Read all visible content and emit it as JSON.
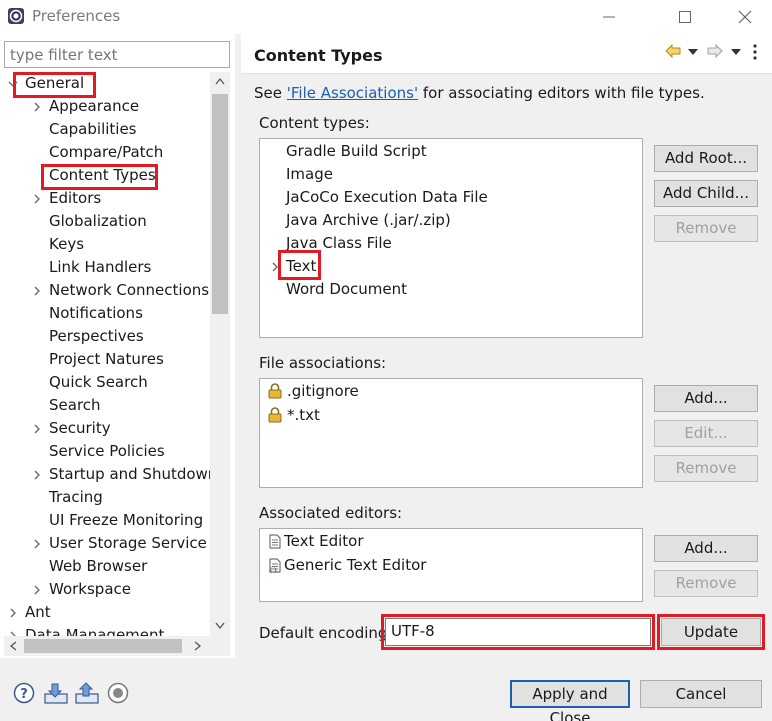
{
  "window": {
    "title": "Preferences"
  },
  "left_panel": {
    "filter_placeholder": "type filter text",
    "tree": [
      {
        "label": "General",
        "level": 0,
        "expanded": true,
        "has_children": true
      },
      {
        "label": "Appearance",
        "level": 1,
        "has_children": true
      },
      {
        "label": "Capabilities",
        "level": 1,
        "has_children": false
      },
      {
        "label": "Compare/Patch",
        "level": 1,
        "has_children": false
      },
      {
        "label": "Content Types",
        "level": 1,
        "has_children": false,
        "selected": true
      },
      {
        "label": "Editors",
        "level": 1,
        "has_children": true
      },
      {
        "label": "Globalization",
        "level": 1,
        "has_children": false
      },
      {
        "label": "Keys",
        "level": 1,
        "has_children": false
      },
      {
        "label": "Link Handlers",
        "level": 1,
        "has_children": false
      },
      {
        "label": "Network Connections",
        "level": 1,
        "has_children": true
      },
      {
        "label": "Notifications",
        "level": 1,
        "has_children": false
      },
      {
        "label": "Perspectives",
        "level": 1,
        "has_children": false
      },
      {
        "label": "Project Natures",
        "level": 1,
        "has_children": false
      },
      {
        "label": "Quick Search",
        "level": 1,
        "has_children": false
      },
      {
        "label": "Search",
        "level": 1,
        "has_children": false
      },
      {
        "label": "Security",
        "level": 1,
        "has_children": true
      },
      {
        "label": "Service Policies",
        "level": 1,
        "has_children": false
      },
      {
        "label": "Startup and Shutdown",
        "level": 1,
        "has_children": true
      },
      {
        "label": "Tracing",
        "level": 1,
        "has_children": false
      },
      {
        "label": "UI Freeze Monitoring",
        "level": 1,
        "has_children": false
      },
      {
        "label": "User Storage Service",
        "level": 1,
        "has_children": true
      },
      {
        "label": "Web Browser",
        "level": 1,
        "has_children": false
      },
      {
        "label": "Workspace",
        "level": 1,
        "has_children": true
      },
      {
        "label": "Ant",
        "level": 0,
        "has_children": true
      },
      {
        "label": "Data Management",
        "level": 0,
        "has_children": true
      }
    ]
  },
  "content": {
    "page_title": "Content Types",
    "see_prefix": "See ",
    "see_link": "'File Associations'",
    "see_suffix": " for associating editors with file types.",
    "content_types_label": "Content types:",
    "content_types": [
      {
        "label": "Gradle Build Script",
        "has_children": false
      },
      {
        "label": "Image",
        "has_children": false
      },
      {
        "label": "JaCoCo Execution Data File",
        "has_children": false
      },
      {
        "label": "Java Archive (.jar/.zip)",
        "has_children": false
      },
      {
        "label": "Java Class File",
        "has_children": false
      },
      {
        "label": "Text",
        "has_children": true,
        "selected": true
      },
      {
        "label": "Word Document",
        "has_children": false
      }
    ],
    "add_root_label": "Add Root...",
    "add_child_label": "Add Child...",
    "remove_label": "Remove",
    "file_assoc_label": "File associations:",
    "file_associations": [
      ".gitignore",
      "*.txt"
    ],
    "add_label": "Add...",
    "edit_label": "Edit...",
    "assoc_editors_label": "Associated editors:",
    "associated_editors": [
      "Text Editor",
      "Generic Text Editor"
    ],
    "default_encoding_label": "Default encoding:",
    "default_encoding_value": "UTF-8",
    "update_label": "Update"
  },
  "bottom": {
    "apply_close_label": "Apply and Close",
    "cancel_label": "Cancel"
  },
  "colors": {
    "highlight": "#e01b24",
    "link": "#1a5fb4"
  }
}
